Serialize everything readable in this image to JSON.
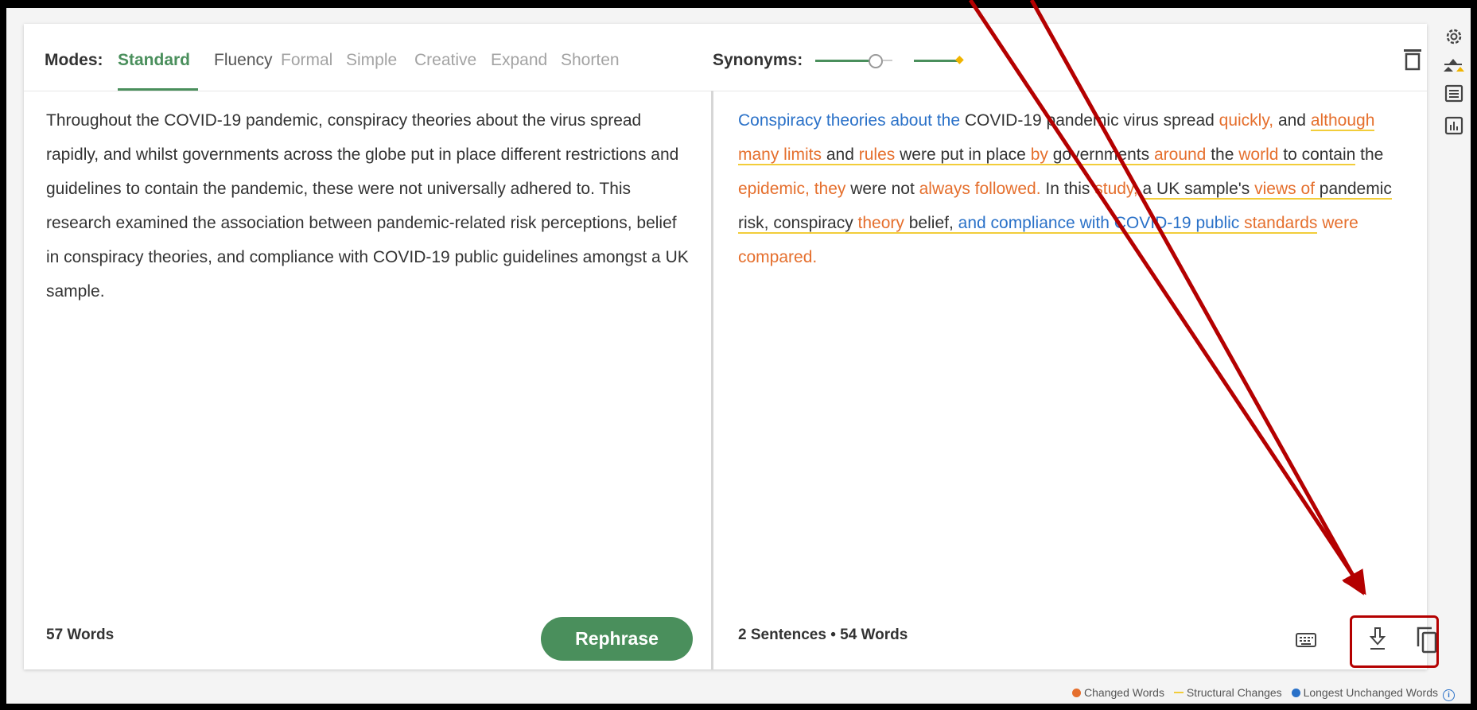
{
  "modes": {
    "label": "Modes:",
    "items": [
      "Standard",
      "Fluency",
      "Formal",
      "Simple",
      "Creative",
      "Expand",
      "Shorten"
    ],
    "active": "Standard"
  },
  "synonyms": {
    "label": "Synonyms:",
    "level_fraction": 0.35
  },
  "input": {
    "text": "Throughout the COVID-19 pandemic, conspiracy theories about the virus spread rapidly, and whilst governments across the globe put in place different restrictions and guidelines to contain the pandemic, these were not universally adhered to. This research examined the association between pandemic-related risk perceptions, belief in conspiracy theories, and compliance with COVID-19 public guidelines amongst a UK sample.",
    "word_count": "57 Words"
  },
  "rephrase_label": "Rephrase",
  "output": {
    "segments": [
      {
        "t": "Conspiracy theories about the",
        "k": "l"
      },
      {
        "t": " COVID-19 pandemic virus spread ",
        "k": ""
      },
      {
        "t": "quickly,",
        "k": "c"
      },
      {
        "t": " and ",
        "k": ""
      },
      {
        "t": "although many limits",
        "k": "c s"
      },
      {
        "t": " and ",
        "k": "s"
      },
      {
        "t": "rules",
        "k": "c s"
      },
      {
        "t": " were put in place ",
        "k": "s"
      },
      {
        "t": "by",
        "k": "c s"
      },
      {
        "t": " governments ",
        "k": "s"
      },
      {
        "t": "around",
        "k": "c s"
      },
      {
        "t": " the ",
        "k": "s"
      },
      {
        "t": "world",
        "k": "c s"
      },
      {
        "t": " to contain",
        "k": "s"
      },
      {
        "t": " the ",
        "k": ""
      },
      {
        "t": "epidemic, they",
        "k": "c"
      },
      {
        "t": " were not ",
        "k": ""
      },
      {
        "t": "always followed.",
        "k": "c"
      },
      {
        "t": " In this ",
        "k": ""
      },
      {
        "t": "study,",
        "k": "c"
      },
      {
        "t": " ",
        "k": ""
      },
      {
        "t": "a UK sample's ",
        "k": "s"
      },
      {
        "t": "views of",
        "k": "c s"
      },
      {
        "t": " pandemic risk, conspiracy ",
        "k": "s"
      },
      {
        "t": "theory",
        "k": "c s"
      },
      {
        "t": " belief, ",
        "k": "s"
      },
      {
        "t": "and compliance with COVID-19 public",
        "k": "l s"
      },
      {
        "t": " ",
        "k": "s"
      },
      {
        "t": "standards",
        "k": "c s"
      },
      {
        "t": " ",
        "k": ""
      },
      {
        "t": "were compared.",
        "k": "c"
      }
    ],
    "sentence_count": "2 Sentences",
    "separator": "•",
    "word_count": "54 Words"
  },
  "legend": {
    "changed": "Changed Words",
    "structural": "Structural Changes",
    "longest": "Longest Unchanged Words",
    "info": "i"
  },
  "colors": {
    "accent": "#4a8f5c",
    "changed": "#e56f2d",
    "structural": "#f2cd3a",
    "longest": "#2a71c8",
    "annotation": "#b40000"
  }
}
